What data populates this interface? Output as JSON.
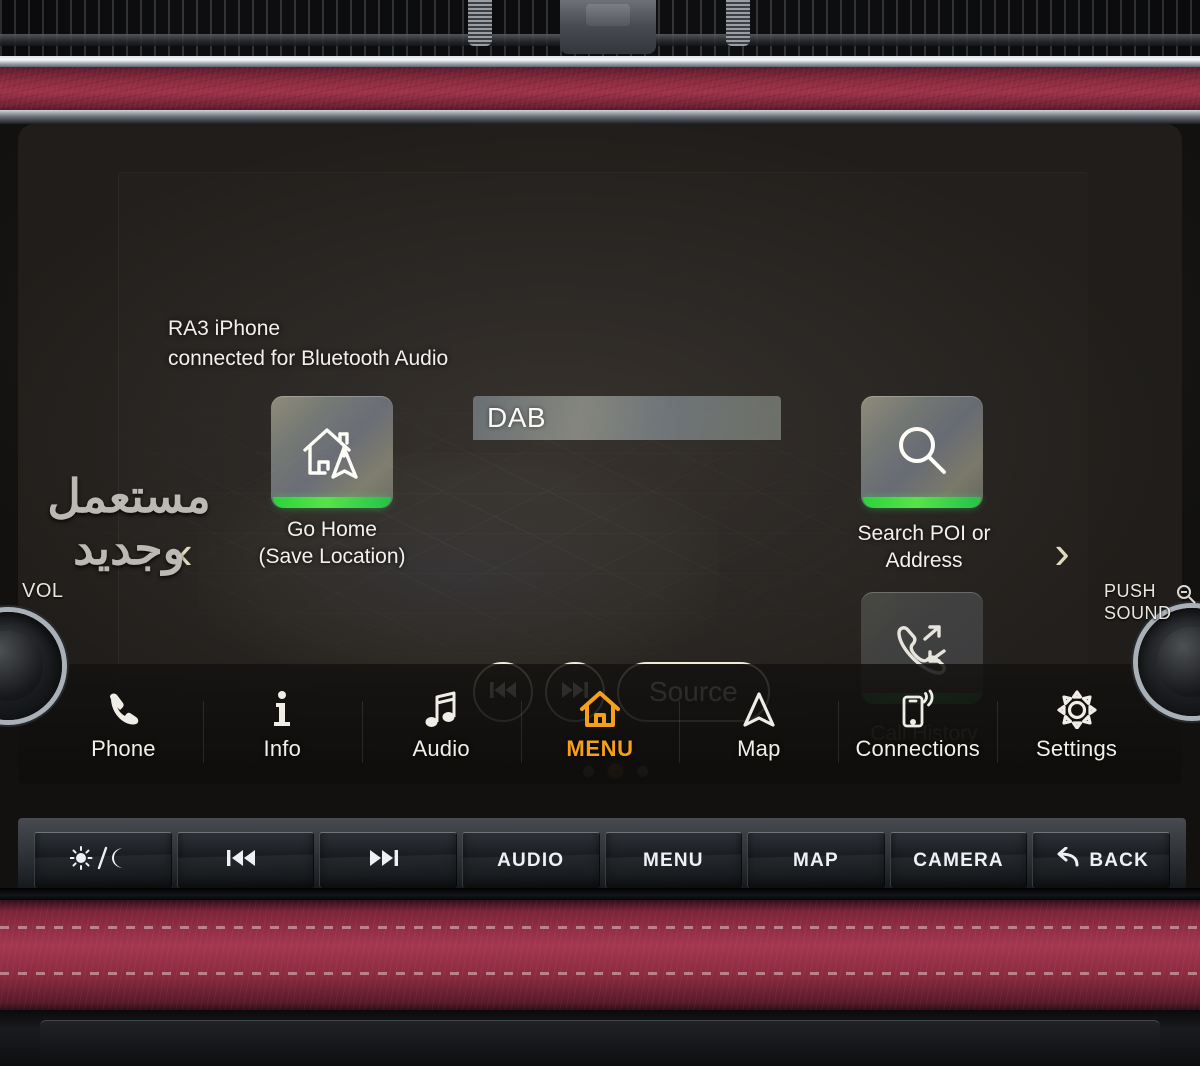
{
  "screen": {
    "status_line1": "RA3 iPhone",
    "status_line2": "connected for Bluetooth Audio",
    "prev_page_chevron": "‹",
    "next_page_chevron": "›",
    "source_banner": {
      "label": "DAB",
      "icon": "audio-source-banner"
    },
    "shortcuts": [
      {
        "id": "go-home",
        "icon": "home-navigation-icon",
        "label_line1": "Go Home",
        "label_line2": "(Save Location)",
        "accent": "#3ad24a",
        "state": "enabled"
      },
      {
        "id": "search-poi",
        "icon": "magnifier-icon",
        "label_line1": "Search POI or",
        "label_line2": "Address",
        "accent": "#3ad24a",
        "state": "enabled"
      },
      {
        "id": "call-history",
        "icon": "phone-arrows-icon",
        "label_line1": "Call History",
        "label_line2": "",
        "accent": "#1e9040",
        "state": "dimmed"
      }
    ],
    "transport": {
      "previous_label": "⏮",
      "next_label": "⏭",
      "source_label": "Source"
    },
    "pager": {
      "total": 3,
      "active_index": 2,
      "active_color": "#f2a01a",
      "inactive_color": "#c6cfcc"
    },
    "tabs": [
      {
        "id": "phone",
        "label": "Phone",
        "icon": "phone-handset-icon",
        "active": false
      },
      {
        "id": "info",
        "label": "Info",
        "icon": "info-i-icon",
        "active": false
      },
      {
        "id": "audio",
        "label": "Audio",
        "icon": "music-note-icon",
        "active": false
      },
      {
        "id": "menu",
        "label": "MENU",
        "icon": "home-icon",
        "active": true
      },
      {
        "id": "map",
        "label": "Map",
        "icon": "navigation-arrow-icon",
        "active": false
      },
      {
        "id": "connections",
        "label": "Connections",
        "icon": "phone-signal-icon",
        "active": false
      },
      {
        "id": "settings",
        "label": "Settings",
        "icon": "gear-icon",
        "active": false
      }
    ],
    "accent_color": "#f5a01b"
  },
  "hardware": {
    "buttons": [
      {
        "id": "day-night",
        "label": "",
        "icon": "sun-moon-icon"
      },
      {
        "id": "seek-down",
        "label": "",
        "icon": "previous-track-icon"
      },
      {
        "id": "seek-up",
        "label": "",
        "icon": "next-track-icon"
      },
      {
        "id": "audio",
        "label": "AUDIO",
        "icon": ""
      },
      {
        "id": "menu",
        "label": "MENU",
        "icon": ""
      },
      {
        "id": "map",
        "label": "MAP",
        "icon": ""
      },
      {
        "id": "camera",
        "label": "CAMERA",
        "icon": ""
      },
      {
        "id": "back",
        "label": "BACK",
        "icon": "back-arrow-icon"
      }
    ],
    "left_knob": {
      "id": "volume-knob",
      "label": "VOL"
    },
    "right_knob": {
      "id": "tune-knob",
      "label_line1": "PUSH",
      "label_line2": "SOUND",
      "side_icon": "seek-tune-icon"
    }
  },
  "watermark": {
    "line1": "مستعمل",
    "line2": "وجديد"
  }
}
